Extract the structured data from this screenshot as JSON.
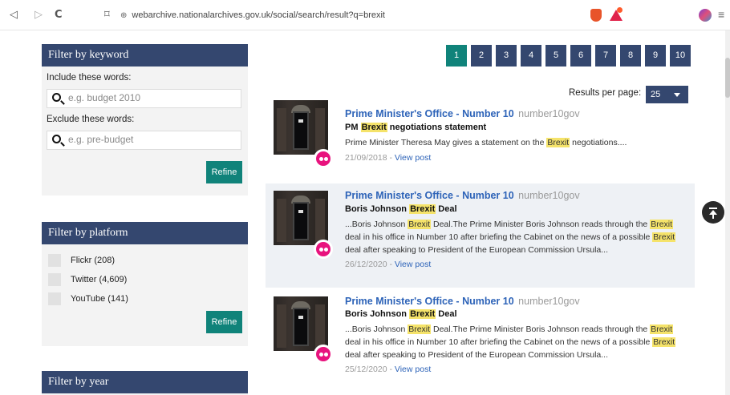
{
  "browser": {
    "back": "◁",
    "forward": "▷",
    "reload": "C",
    "bookmark": "⌑",
    "lock": "⊕",
    "url": "webarchive.nationalarchives.gov.uk/social/search/result?q=brexit",
    "menu": "≡"
  },
  "filters": {
    "keyword": {
      "title": "Filter by keyword",
      "include_label": "Include these words:",
      "include_placeholder": "e.g. budget 2010",
      "exclude_label": "Exclude these words:",
      "exclude_placeholder": "e.g. pre-budget",
      "refine": "Refine"
    },
    "platform": {
      "title": "Filter by platform",
      "options": [
        "Flickr (208)",
        "Twitter (4,609)",
        "YouTube (141)"
      ],
      "refine": "Refine"
    },
    "year": {
      "title": "Filter by year"
    }
  },
  "pagination": {
    "pages": [
      "1",
      "2",
      "3",
      "4",
      "5",
      "6",
      "7",
      "8",
      "9",
      "10"
    ],
    "active": "1"
  },
  "results_per_page": {
    "label": "Results per page:",
    "value": "25"
  },
  "results": [
    {
      "title": "Prime Minister's Office - Number 10",
      "handle": "number10gov",
      "headline": [
        "PM ",
        "Brexit",
        " negotiations statement"
      ],
      "description": [
        "Prime Minister Theresa May gives a statement on the ",
        "Brexit",
        " negotiations...."
      ],
      "date": "21/09/2018",
      "separator": " - ",
      "link": "View post",
      "platform_icon": "flickr-icon"
    },
    {
      "title": "Prime Minister's Office - Number 10",
      "handle": "number10gov",
      "headline": [
        "Boris Johnson ",
        "Brexit",
        " Deal"
      ],
      "description": [
        "...Boris Johnson ",
        "Brexit",
        " Deal.The Prime Minister Boris Johnson reads through the ",
        "Brexit",
        " deal in his office in Number 10 after briefing the Cabinet on the news of a possible ",
        "Brexit",
        " deal after speaking to President of the European Commission Ursula..."
      ],
      "date": "26/12/2020",
      "separator": " - ",
      "link": "View post",
      "platform_icon": "flickr-icon"
    },
    {
      "title": "Prime Minister's Office - Number 10",
      "handle": "number10gov",
      "headline": [
        "Boris Johnson ",
        "Brexit",
        " Deal"
      ],
      "description": [
        "...Boris Johnson ",
        "Brexit",
        " Deal.The Prime Minister Boris Johnson reads through the ",
        "Brexit",
        " deal in his office in Number 10 after briefing the Cabinet on the news of a possible ",
        "Brexit",
        " deal after speaking to President of the European Commission Ursula..."
      ],
      "date": "25/12/2020",
      "separator": " - ",
      "link": "View post",
      "platform_icon": "flickr-icon"
    }
  ],
  "colors": {
    "header_navy": "#34476f",
    "accent_teal": "#10837a",
    "link_blue": "#2d63b8",
    "highlight": "#f5e36a",
    "flickr_pink": "#e8137e"
  }
}
